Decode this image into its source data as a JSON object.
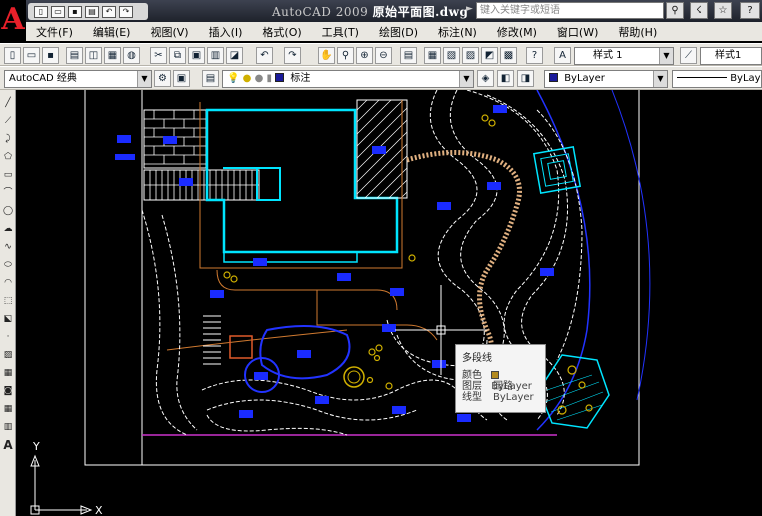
{
  "titlebar": {
    "title_prefix": "AutoCAD 2009",
    "title_file": "原始平面图.dwg",
    "search_placeholder": "键入关键字或短语",
    "qa_icons": [
      "new-icon",
      "open-icon",
      "save-icon",
      "print-icon",
      "undo-icon",
      "redo-icon"
    ]
  },
  "menu": [
    "文件(F)",
    "编辑(E)",
    "视图(V)",
    "插入(I)",
    "格式(O)",
    "工具(T)",
    "绘图(D)",
    "标注(N)",
    "修改(M)",
    "窗口(W)",
    "帮助(H)"
  ],
  "toolbar1": {
    "text_style": "样式 1",
    "dim_style": "样式1"
  },
  "toolbar2": {
    "workspace": "AutoCAD 经典",
    "layer": "标注",
    "color": "ByLayer",
    "linetype": "ByLayer"
  },
  "ucs": {
    "x_label": "X",
    "y_label": "Y"
  },
  "tooltip": {
    "title": "多段线",
    "rows": [
      {
        "key": "颜色",
        "value": "ByLayer"
      },
      {
        "key": "图层",
        "value": "园路"
      },
      {
        "key": "线型",
        "value": "ByLayer"
      }
    ]
  },
  "colors": {
    "background": "#000000",
    "building": "#00e5ff",
    "paths": "#ffffff",
    "labels": "#1a2bff",
    "edge": "#d07070"
  }
}
